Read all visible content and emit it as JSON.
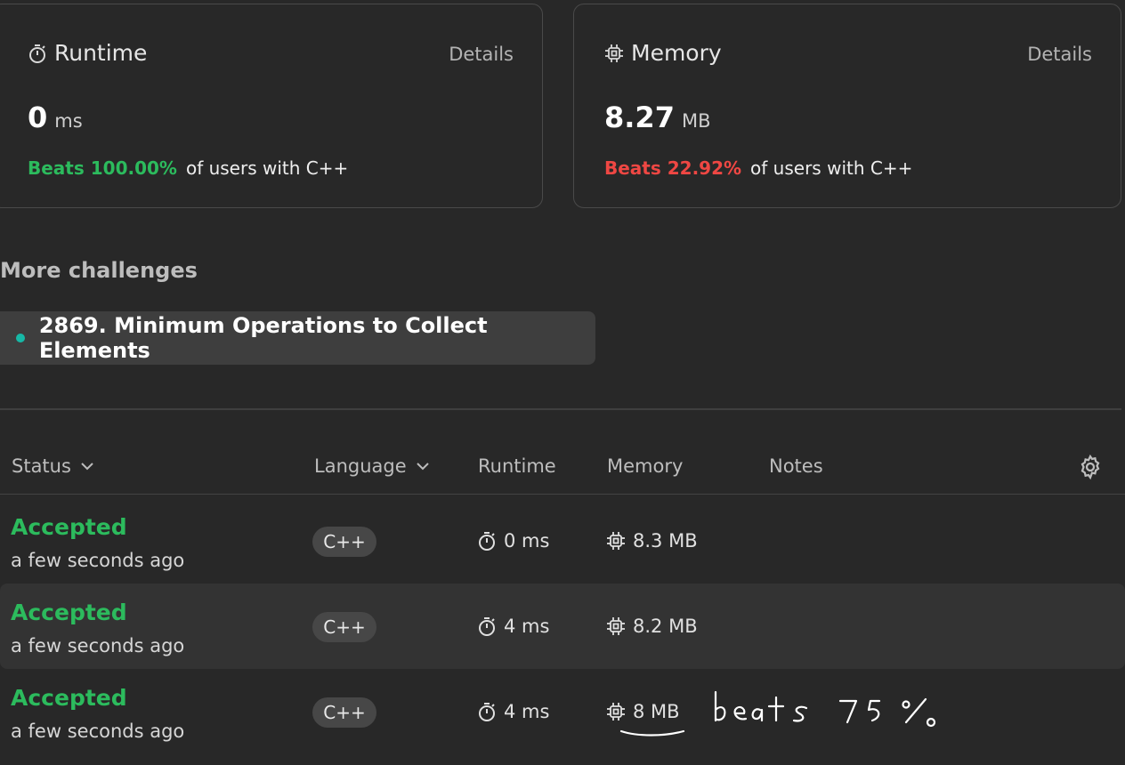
{
  "runtime_card": {
    "title": "Runtime",
    "details_label": "Details",
    "value": "0",
    "unit": "ms",
    "beats_text": "Beats 100.00%",
    "beats_suffix": "of users with C++",
    "beats_color": "#2cbb5d"
  },
  "memory_card": {
    "title": "Memory",
    "details_label": "Details",
    "value": "8.27",
    "unit": "MB",
    "beats_text": "Beats 22.92%",
    "beats_suffix": "of users with C++",
    "beats_color": "#ef4743"
  },
  "more_challenges": {
    "title": "More challenges",
    "items": [
      {
        "label": "2869. Minimum Operations to Collect Elements",
        "dot_color": "#17b8a6"
      }
    ]
  },
  "table": {
    "headers": {
      "status": "Status",
      "language": "Language",
      "runtime": "Runtime",
      "memory": "Memory",
      "notes": "Notes"
    },
    "rows": [
      {
        "status": "Accepted",
        "time": "a few seconds ago",
        "language": "C++",
        "runtime": "0 ms",
        "memory": "8.3 MB"
      },
      {
        "status": "Accepted",
        "time": "a few seconds ago",
        "language": "C++",
        "runtime": "4 ms",
        "memory": "8.2 MB"
      },
      {
        "status": "Accepted",
        "time": "a few seconds ago",
        "language": "C++",
        "runtime": "4 ms",
        "memory": "8 MB"
      }
    ]
  },
  "handwritten_note": "beats 75%",
  "icons": {
    "runtime": "stopwatch-icon",
    "memory": "chip-icon",
    "sort": "chevron-down-icon",
    "settings": "gear-icon"
  }
}
